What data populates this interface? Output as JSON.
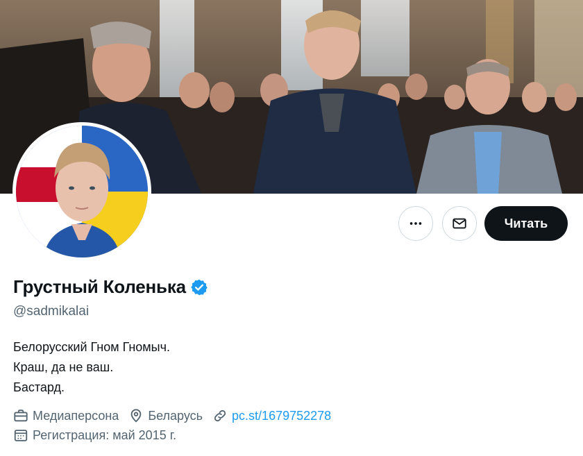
{
  "profile": {
    "display_name": "Грустный Коленька",
    "verified": true,
    "handle": "@sadmikalai",
    "bio_lines": [
      "Белорусский Гном Гномыч.",
      "Краш, да не ваш.",
      "Бастард."
    ],
    "category": "Медиаперсона",
    "location": "Беларусь",
    "website": "pc.st/1679752278",
    "joined": "Регистрация: май 2015 г."
  },
  "actions": {
    "more_icon": "more-horizontal-icon",
    "message_icon": "envelope-icon",
    "follow_label": "Читать"
  },
  "icons": {
    "category": "briefcase-icon",
    "location": "map-pin-icon",
    "website": "link-icon",
    "joined": "calendar-icon",
    "verified": "verified-badge-icon"
  },
  "colors": {
    "verified_blue": "#1d9bf0",
    "link_blue": "#1d9bf0",
    "follow_bg": "#0f1419",
    "secondary_text": "#536471",
    "flag_blue": "#2a67c4",
    "flag_yellow": "#f6cf1e",
    "flag_red": "#c8102e"
  }
}
